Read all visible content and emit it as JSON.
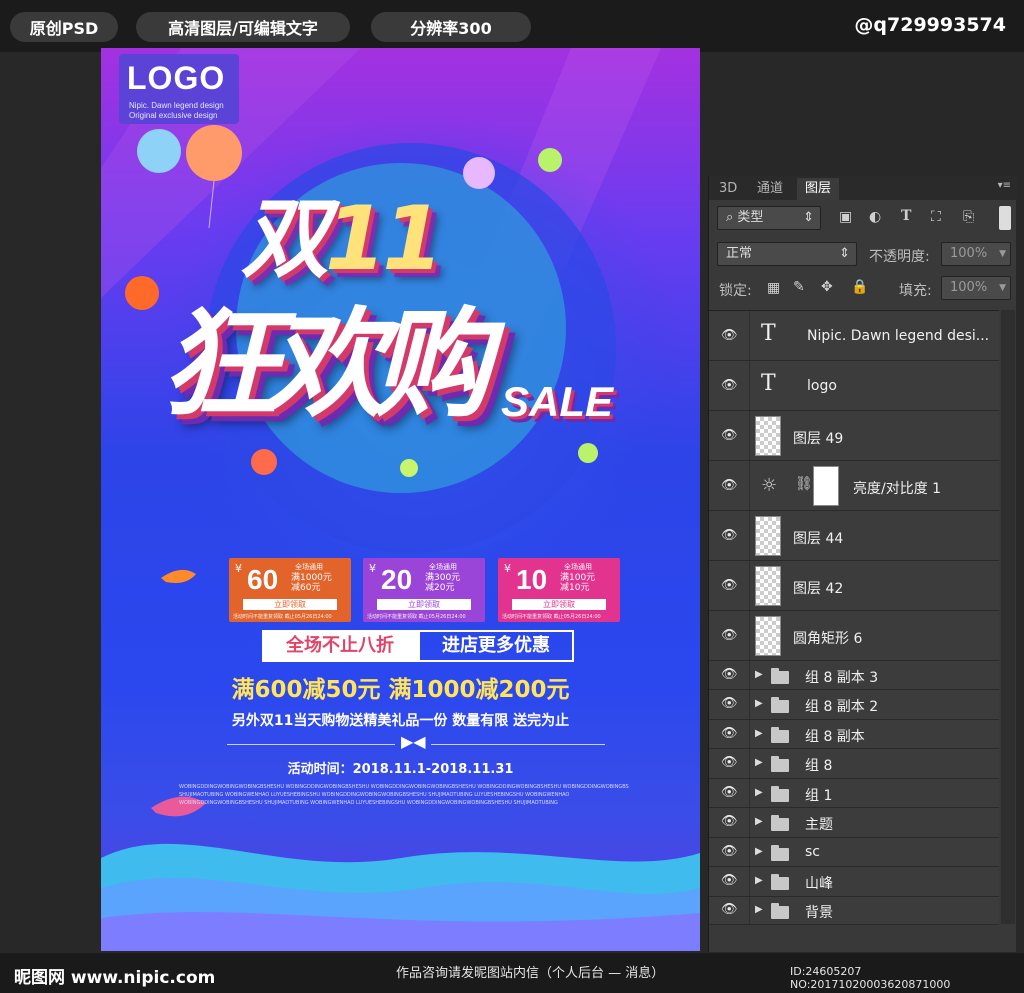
{
  "topbar": {
    "tag1": "原创PSD",
    "tag2": "高清图层/可编辑文字",
    "tag3": "分辨率300",
    "qq": "@q729993574"
  },
  "poster": {
    "logo": "LOGO",
    "logo_sub1": "Nipic. Dawn legend design",
    "logo_sub2": "Original exclusive design",
    "title_a": "双",
    "title_b": "11",
    "title_main": "狂欢购",
    "sale": "SALE",
    "coupons": [
      {
        "yen": "¥",
        "amount": "60",
        "cond": "全场通用",
        "detail1": "满1000元",
        "detail2": "减60元",
        "btn": "立即领取",
        "note": "活动时间不能重复领取 截止05月26日24:00",
        "color": "#e2642a"
      },
      {
        "yen": "¥",
        "amount": "20",
        "cond": "全场通用",
        "detail1": "满300元",
        "detail2": "减20元",
        "btn": "立即领取",
        "note": "活动时间不能重复领取 截止05月26日24:00",
        "color": "#9b44d8"
      },
      {
        "yen": "¥",
        "amount": "10",
        "cond": "全场通用",
        "detail1": "满100元",
        "detail2": "减10元",
        "btn": "立即领取",
        "note": "活动时间不能重复领取 截止05月26日24:00",
        "color": "#e2338f"
      }
    ],
    "promo_left": "全场不止八折",
    "promo_right": "进店更多优惠",
    "headline": "满600减50元  满1000减200元",
    "subline": "另外双11当天购物送精美礼品一份  数量有限 送完为止",
    "bow": "▶◀",
    "date": "活动时间：2018.11.1-2018.11.31",
    "tiny1": "WOBINGDDINGWOBINGWOBINGBSHESHU WOBINGDDINGWOBINGBSHESHU WOBINGDDINGWOBINGWOBINGBSHESHU WOBINGDDINGWOBINGBSHESHU WOBINGDDINGWOBINGBSHESHU",
    "tiny2": "SHUJIMAOTUBING WOBINGWENHAO LUYUESHEBINGSHU WOBINGDDINGWOBINGWOBINGBSHESHU SHUJIMAOTUBING LUYUESHEBINGSHU WOBINGWENHAO",
    "tiny3": "WOBINGDDINGWOBINGBSHESHU SHUJIMAOTUBING WOBINGWENHAO LUYUESHEBINGSHU WOBINGDDINGWOBINGWOBINGBSHESHU SHUJIMAOTUBING"
  },
  "panel": {
    "tabs": [
      "3D",
      "通道",
      "图层"
    ],
    "filter_kind": "类型",
    "blend_mode": "正常",
    "opacity_label": "不透明度:",
    "opacity_value": "100%",
    "lock_label": "锁定:",
    "fill_label": "填充:",
    "fill_value": "100%",
    "layers": [
      {
        "name": "Nipic. Dawn legend desi...",
        "kind": "text"
      },
      {
        "name": "logo",
        "kind": "text"
      },
      {
        "name": "图层 49",
        "kind": "pixel"
      },
      {
        "name": "亮度/对比度 1",
        "kind": "adjust"
      },
      {
        "name": "图层 44",
        "kind": "pixel"
      },
      {
        "name": "图层 42",
        "kind": "pixel"
      },
      {
        "name": "圆角矩形 6",
        "kind": "shape"
      },
      {
        "name": "组 8 副本 3",
        "kind": "group"
      },
      {
        "name": "组 8 副本 2",
        "kind": "group"
      },
      {
        "name": "组 8 副本",
        "kind": "group"
      },
      {
        "name": "组 8",
        "kind": "group"
      },
      {
        "name": "组 1",
        "kind": "group"
      },
      {
        "name": "主题",
        "kind": "group"
      },
      {
        "name": "sc",
        "kind": "group"
      },
      {
        "name": "山峰",
        "kind": "group"
      },
      {
        "name": "背景",
        "kind": "group"
      }
    ]
  },
  "bottombar": {
    "brand": "昵图网 www.nipic.com",
    "consult": "作品咨询请发昵图站内信（个人后台 — 消息）",
    "id": "ID:24605207 NO:20171020003620871000"
  }
}
